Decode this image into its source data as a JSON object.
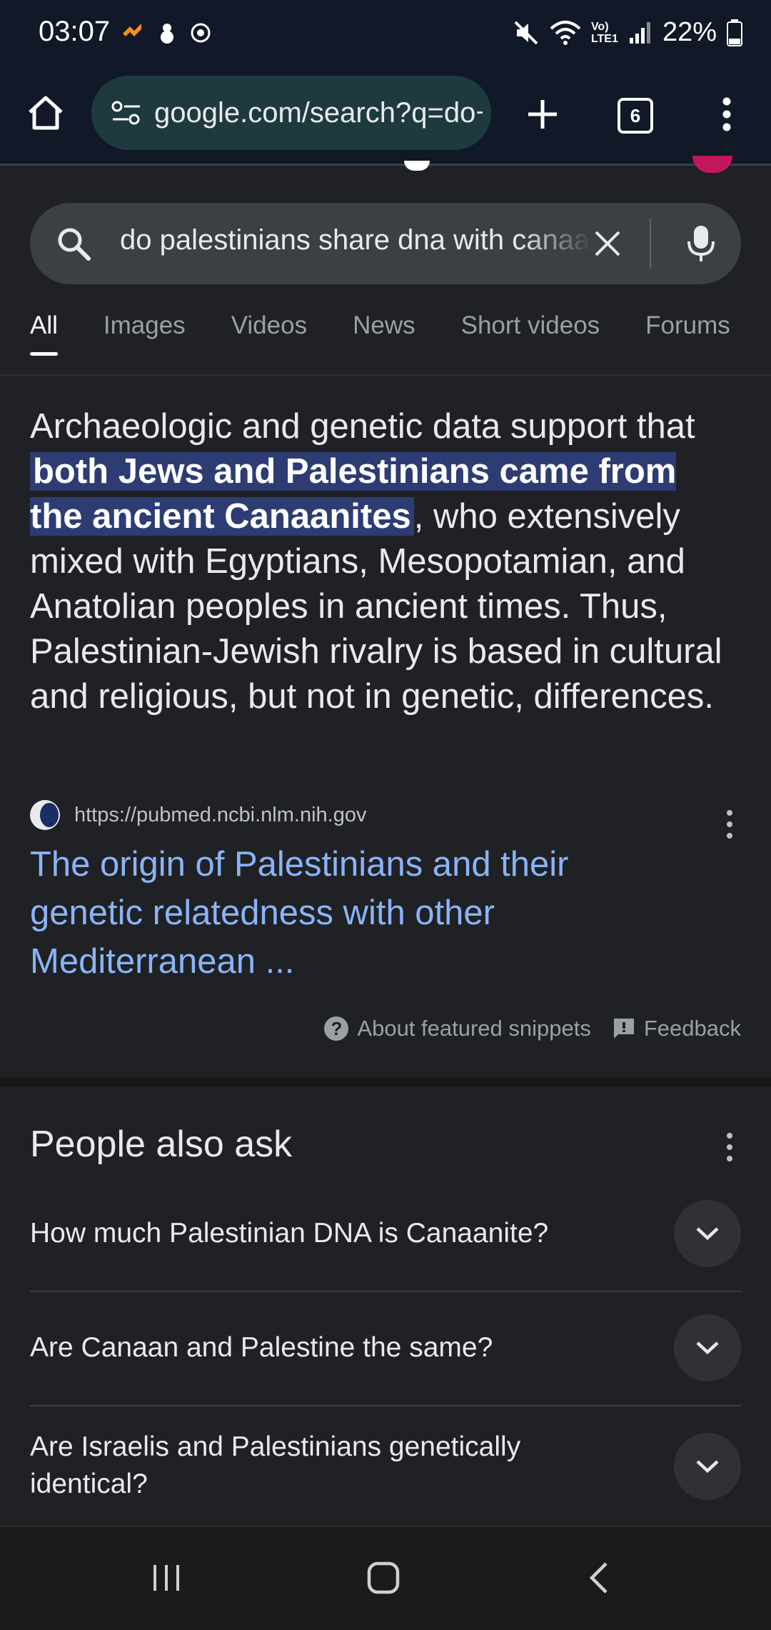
{
  "status_bar": {
    "time": "03:07",
    "battery": "22%",
    "network_label": "Vo) LTE1"
  },
  "browser": {
    "url": "google.com/search?q=do+palestinians+share+dna+with+canaanites",
    "tab_count": "6"
  },
  "search": {
    "query": "do palestinians share dna with canaanites"
  },
  "tabs": [
    "All",
    "Images",
    "Videos",
    "News",
    "Short videos",
    "Forums"
  ],
  "snippet": {
    "pre": "Archaeologic and genetic data support that ",
    "highlight": "both Jews and Palestinians came from the ancient Canaanites",
    "post": ", who extensively mixed with Egyptians, Mesopotamian, and Anatolian peoples in ancient times. Thus, Palestinian-Jewish rivalry is based in cultural and religious, but not in genetic, differences.",
    "source_url": "https://pubmed.ncbi.nlm.nih.gov",
    "result_title": "The origin of Palestinians and their genetic relatedness with other Mediterranean ...",
    "about_label": "About featured snippets",
    "feedback_label": "Feedback"
  },
  "people_also_ask": {
    "title": "People also ask",
    "questions": [
      "How much Palestinian DNA is Canaanite?",
      "Are Canaan and Palestine the same?",
      "Are Israelis and Palestinians genetically identical?"
    ]
  },
  "colors": {
    "background": "#202124",
    "link": "#8ab4f8",
    "highlight": "#2d3c73",
    "url_bar": "#1e3a3f"
  }
}
